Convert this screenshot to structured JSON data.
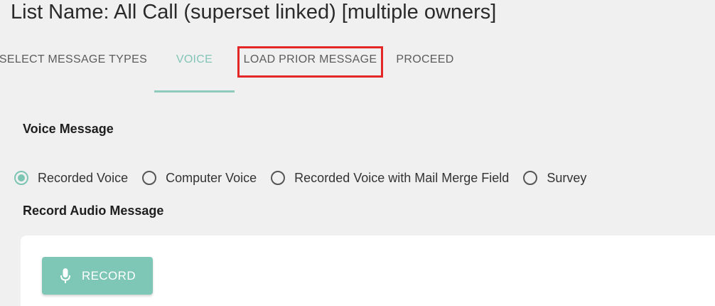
{
  "page": {
    "title": "List Name: All Call (superset linked) [multiple owners]"
  },
  "tabs": [
    {
      "label": "SELECT MESSAGE TYPES",
      "active": false
    },
    {
      "label": "VOICE",
      "active": true
    },
    {
      "label": "LOAD PRIOR MESSAGE",
      "active": false,
      "highlighted": true
    },
    {
      "label": "PROCEED",
      "active": false
    }
  ],
  "voice_message": {
    "label": "Voice Message",
    "options": [
      {
        "label": "Recorded Voice",
        "selected": true
      },
      {
        "label": "Computer Voice",
        "selected": false
      },
      {
        "label": "Recorded Voice with Mail Merge Field",
        "selected": false
      },
      {
        "label": "Survey",
        "selected": false
      }
    ]
  },
  "record_audio": {
    "label": "Record Audio Message",
    "button_label": "RECORD",
    "button_icon": "microphone-icon"
  },
  "colors": {
    "accent": "#7ec6b5",
    "highlight_border": "#e32626",
    "background": "#f0f0f0"
  }
}
